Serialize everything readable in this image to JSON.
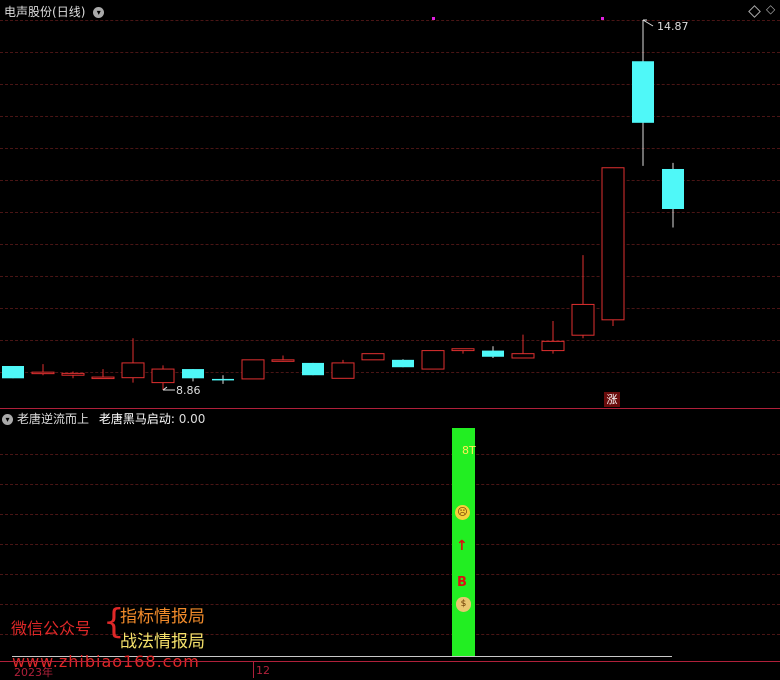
{
  "main_panel": {
    "title": "电声股份",
    "period": "(日线)",
    "high_label": "14.87",
    "low_label": "8.86",
    "zhang_badge": "涨",
    "colors": {
      "up": "#e03030",
      "down": "#4ff8f8",
      "purple_dot": "#e020e0"
    }
  },
  "indicator_panel": {
    "name": "老唐逆流而上",
    "line_label": "老唐黑马启动:",
    "line_value": "0.00",
    "signal_text": "8T",
    "bar_color": "#22ee22",
    "icons": [
      "sad-face-icon",
      "up-arrow-icon",
      "b-marker-icon",
      "money-bag-icon"
    ],
    "b_text": "B"
  },
  "x_axis": {
    "year_label": "2023年",
    "month_label": "12"
  },
  "watermark": {
    "wechat_label": "微信公众号",
    "brace": "{",
    "line1": "指标情报局",
    "line2": "战法情报局",
    "url": "www.zhibiao168.com"
  },
  "chart_data": {
    "type": "candlestick",
    "title": "电声股份(日线)",
    "y_annotations": {
      "max": 14.87,
      "min": 8.86
    },
    "candles": [
      {
        "o": 9.25,
        "h": 9.25,
        "l": 9.05,
        "c": 9.05
      },
      {
        "o": 9.15,
        "h": 9.28,
        "l": 9.1,
        "c": 9.15
      },
      {
        "o": 9.1,
        "h": 9.16,
        "l": 9.05,
        "c": 9.13
      },
      {
        "o": 9.07,
        "h": 9.2,
        "l": 9.07,
        "c": 9.07
      },
      {
        "o": 9.06,
        "h": 9.7,
        "l": 8.98,
        "c": 9.3
      },
      {
        "o": 8.98,
        "h": 9.26,
        "l": 8.86,
        "c": 9.2
      },
      {
        "o": 9.2,
        "h": 9.2,
        "l": 9.0,
        "c": 9.05
      },
      {
        "o": 9.04,
        "h": 9.1,
        "l": 8.96,
        "c": 9.03
      },
      {
        "o": 9.04,
        "h": 9.35,
        "l": 9.04,
        "c": 9.35
      },
      {
        "o": 9.35,
        "h": 9.42,
        "l": 9.32,
        "c": 9.35
      },
      {
        "o": 9.3,
        "h": 9.3,
        "l": 9.1,
        "c": 9.1
      },
      {
        "o": 9.05,
        "h": 9.35,
        "l": 9.05,
        "c": 9.3
      },
      {
        "o": 9.35,
        "h": 9.45,
        "l": 9.35,
        "c": 9.45
      },
      {
        "o": 9.35,
        "h": 9.36,
        "l": 9.23,
        "c": 9.23
      },
      {
        "o": 9.2,
        "h": 9.5,
        "l": 9.2,
        "c": 9.5
      },
      {
        "o": 9.5,
        "h": 9.53,
        "l": 9.45,
        "c": 9.53
      },
      {
        "o": 9.5,
        "h": 9.57,
        "l": 9.38,
        "c": 9.4
      },
      {
        "o": 9.38,
        "h": 9.76,
        "l": 9.38,
        "c": 9.45
      },
      {
        "o": 9.5,
        "h": 9.98,
        "l": 9.45,
        "c": 9.65
      },
      {
        "o": 9.75,
        "h": 11.05,
        "l": 9.7,
        "c": 10.25
      },
      {
        "o": 10.0,
        "h": 12.47,
        "l": 9.9,
        "c": 12.47
      },
      {
        "o": 14.2,
        "h": 14.87,
        "l": 12.5,
        "c": 13.2
      },
      {
        "o": 12.45,
        "h": 12.55,
        "l": 11.5,
        "c": 11.8
      }
    ],
    "markers": {
      "purple_dot_candles": [
        14,
        20
      ],
      "zhang_candle": 20
    },
    "indicator_bar_candle": 15
  }
}
